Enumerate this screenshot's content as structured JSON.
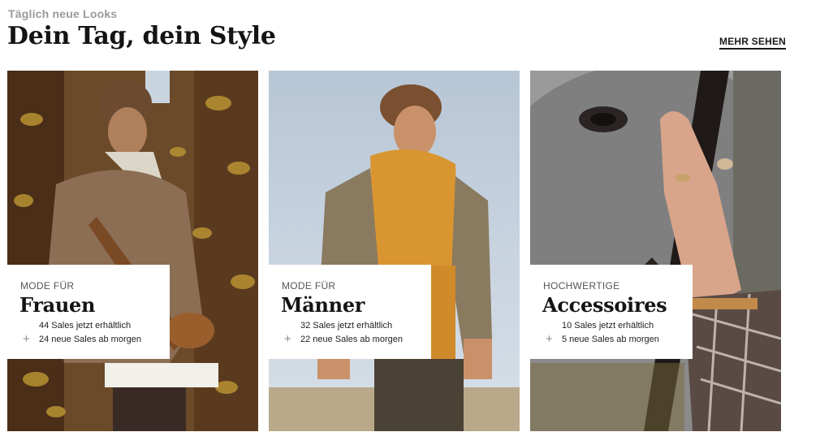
{
  "header": {
    "eyebrow": "Täglich neue Looks",
    "title": "Dein Tag, dein Style",
    "more_link": "MEHR SEHEN"
  },
  "cards": [
    {
      "kicker": "MODE FÜR",
      "title": "Frauen",
      "available": "44 Sales jetzt erhältlich",
      "upcoming": "24 neue Sales ab morgen",
      "image": "woman-in-autumn-jacket-photo"
    },
    {
      "kicker": "MODE FÜR",
      "title": "Männer",
      "available": "32 Sales jetzt erhältlich",
      "upcoming": "22 neue Sales ab morgen",
      "image": "man-in-orange-hoodie-photo"
    },
    {
      "kicker": "HOCHWERTIGE",
      "title": "Accessoires",
      "available": "10 Sales jetzt erhältlich",
      "upcoming": "5 neue Sales ab morgen",
      "image": "hand-with-rings-on-horse-photo"
    }
  ],
  "icons": {
    "plus": "+"
  }
}
